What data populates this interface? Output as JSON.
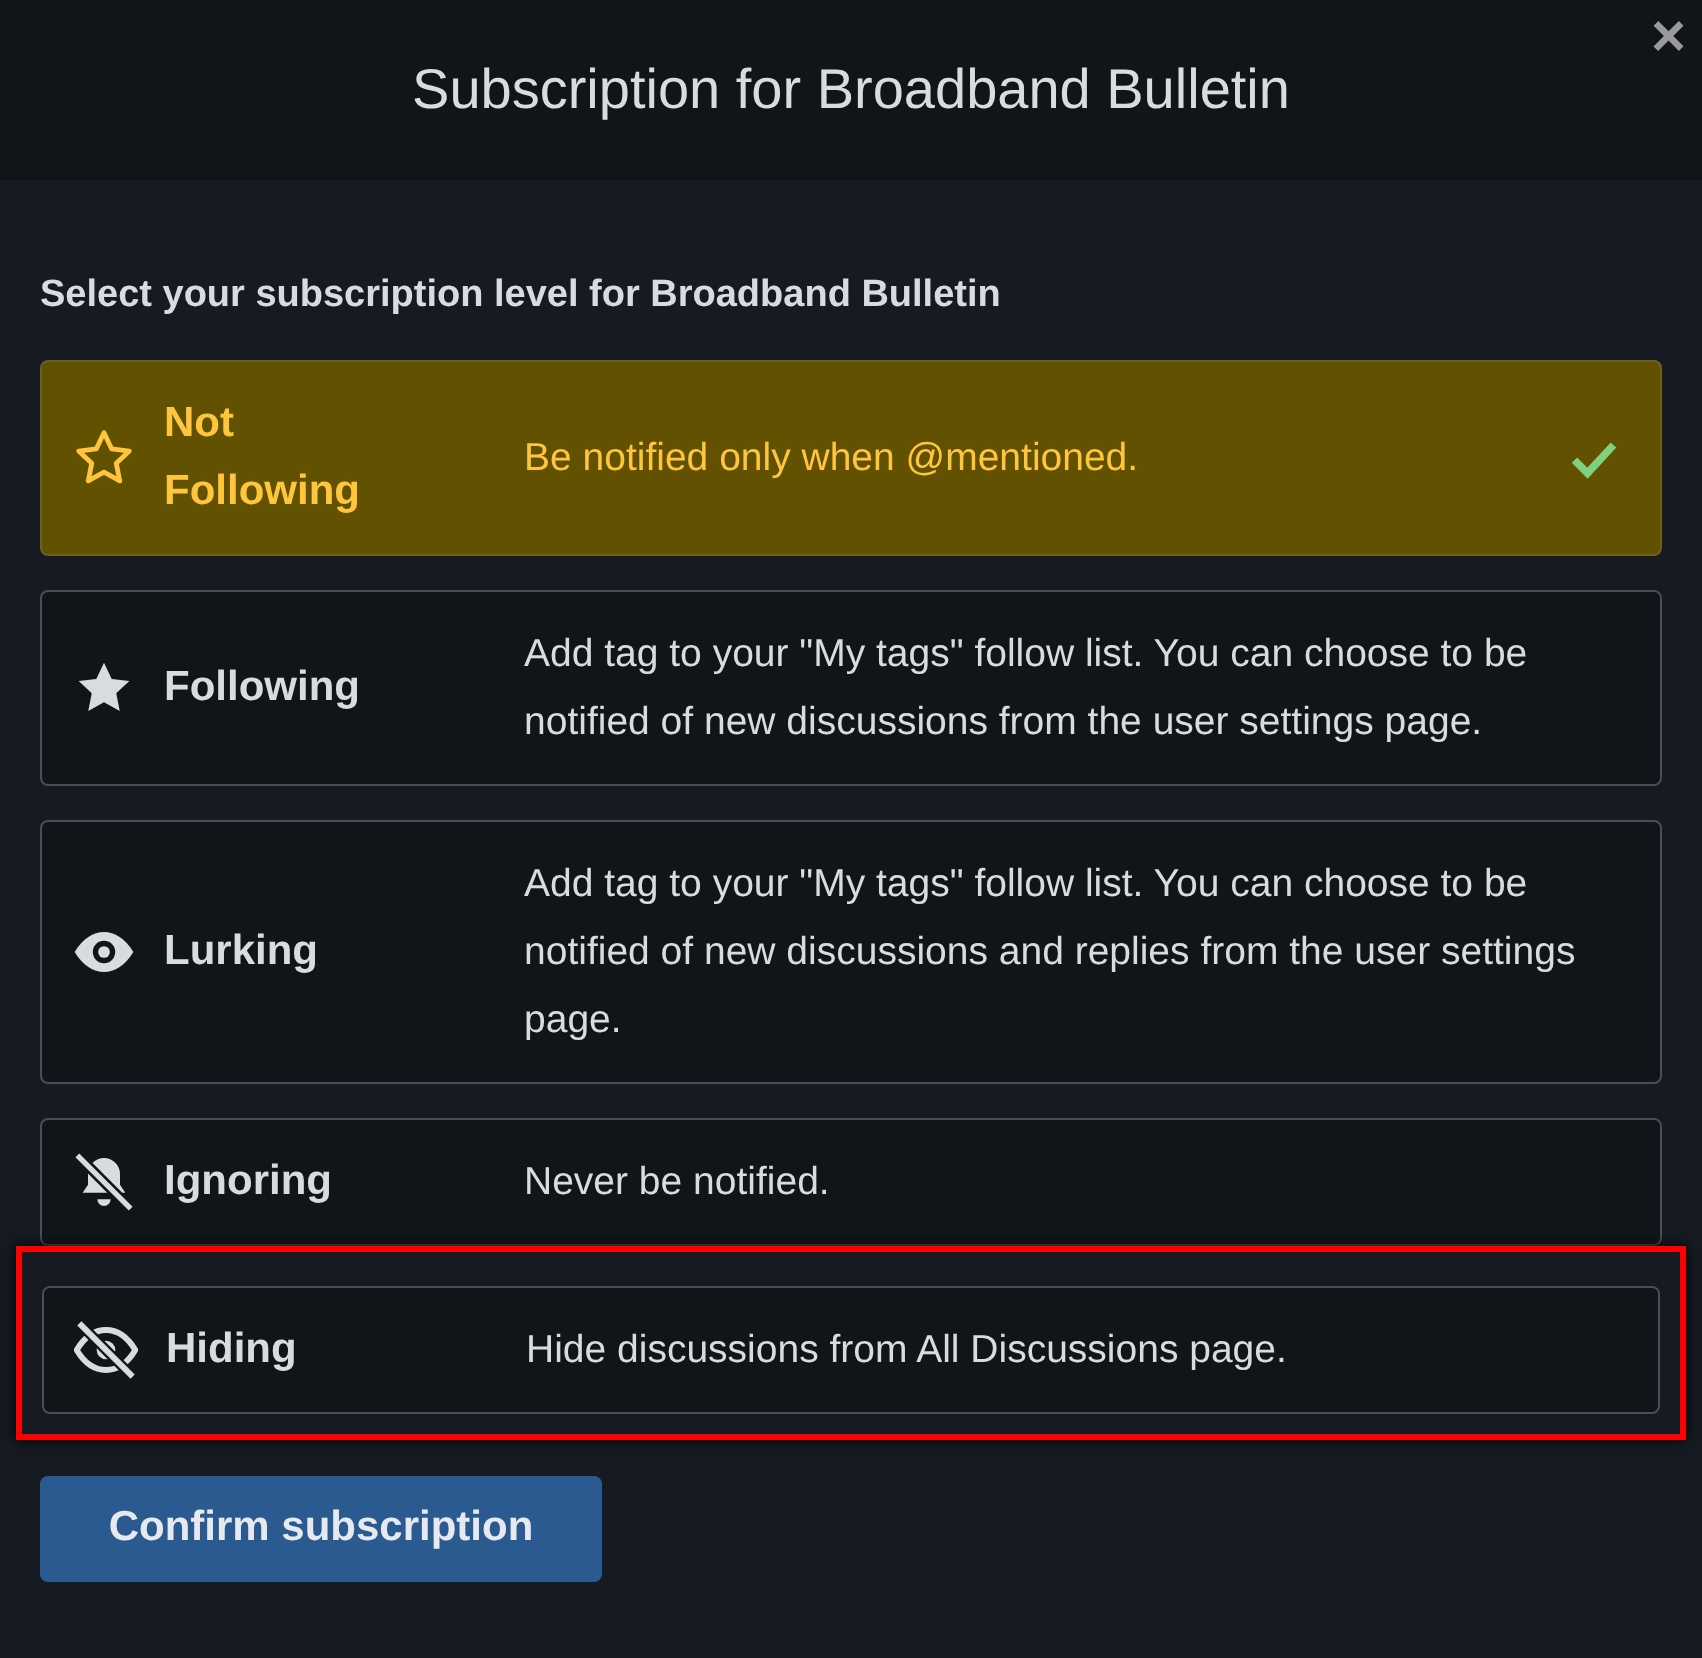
{
  "dialog": {
    "title": "Subscription for Broadband Bulletin",
    "close": "×"
  },
  "prompt": "Select your subscription level for Broadband Bulletin",
  "options": [
    {
      "label": "Not Following",
      "description": "Be notified only when @mentioned.",
      "selected": true,
      "highlighted": false
    },
    {
      "label": "Following",
      "description": "Add tag to your \"My tags\" follow list. You can choose to be notified of new discussions from the user settings page.",
      "selected": false,
      "highlighted": false
    },
    {
      "label": "Lurking",
      "description": "Add tag to your \"My tags\" follow list. You can choose to be notified of new discussions and replies from the user settings page.",
      "selected": false,
      "highlighted": false
    },
    {
      "label": "Ignoring",
      "description": "Never be notified.",
      "selected": false,
      "highlighted": false
    },
    {
      "label": "Hiding",
      "description": "Hide discussions from All Discussions page.",
      "selected": false,
      "highlighted": true
    }
  ],
  "confirm_button": "Confirm subscription"
}
